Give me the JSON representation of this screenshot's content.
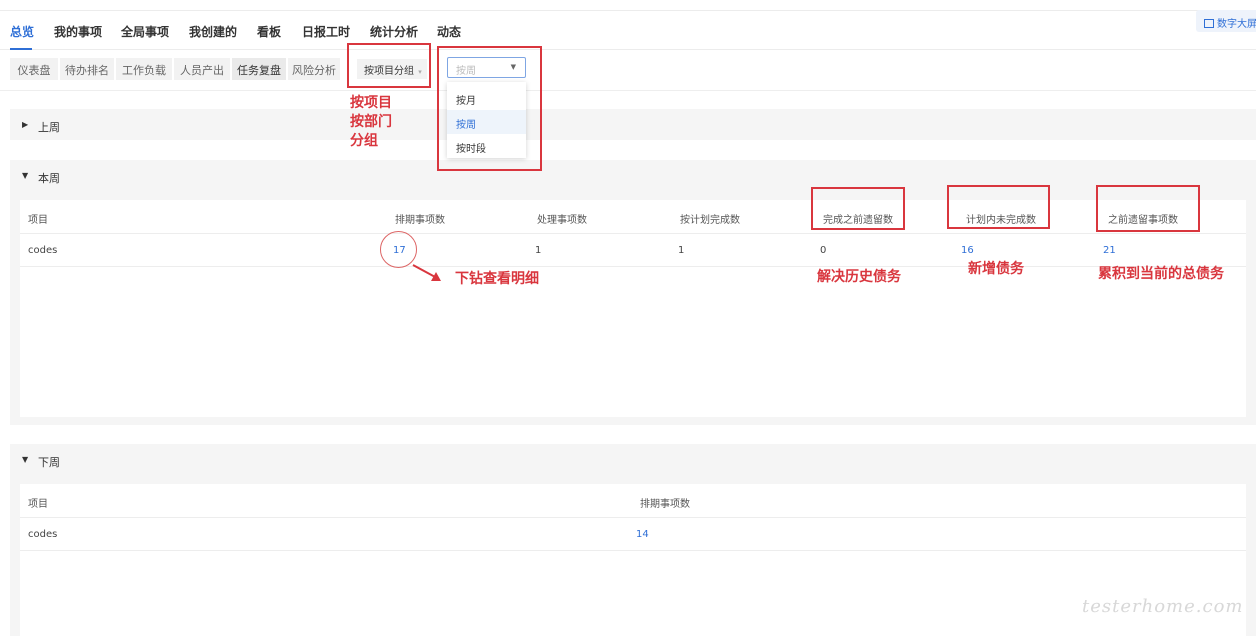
{
  "nav": {
    "tabs": [
      "总览",
      "我的事项",
      "全局事项",
      "我创建的",
      "看板",
      "日报工时",
      "统计分析",
      "动态"
    ],
    "active_tab": "总览",
    "big_screen_button": "数字大屏"
  },
  "subnav": {
    "tabs": [
      "仪表盘",
      "待办排名",
      "工作负载",
      "人员产出",
      "任务复盘",
      "风险分析"
    ],
    "active_tab": "任务复盘"
  },
  "filters": {
    "group_select": "按项目分组",
    "period_select_placeholder": "按周",
    "period_options": [
      "按月",
      "按周",
      "按时段"
    ],
    "selected_option": "按周"
  },
  "sections": {
    "last_week": {
      "title": "上周"
    },
    "this_week": {
      "title": "本周",
      "headers": [
        "项目",
        "排期事项数",
        "处理事项数",
        "按计划完成数",
        "完成之前遗留数",
        "计划内未完成数",
        "之前遗留事项数"
      ],
      "row": [
        "codes",
        "17",
        "1",
        "1",
        "0",
        "16",
        "21"
      ]
    },
    "next_week": {
      "title": "下周",
      "headers": [
        "项目",
        "排期事项数"
      ],
      "row": [
        "codes",
        "14"
      ]
    }
  },
  "annotations": {
    "group_note": "按项目\n按部门\n分组",
    "drilldown_note": "下钻查看明细",
    "resolve_note": "解决历史债务",
    "new_debt_note": "新增债务",
    "total_debt_note": "累积到当前的总债务",
    "color": "#d9363e"
  },
  "watermark": "testerhome.com",
  "colors": {
    "accent": "#2f6fd6",
    "annotation": "#d9363e"
  }
}
